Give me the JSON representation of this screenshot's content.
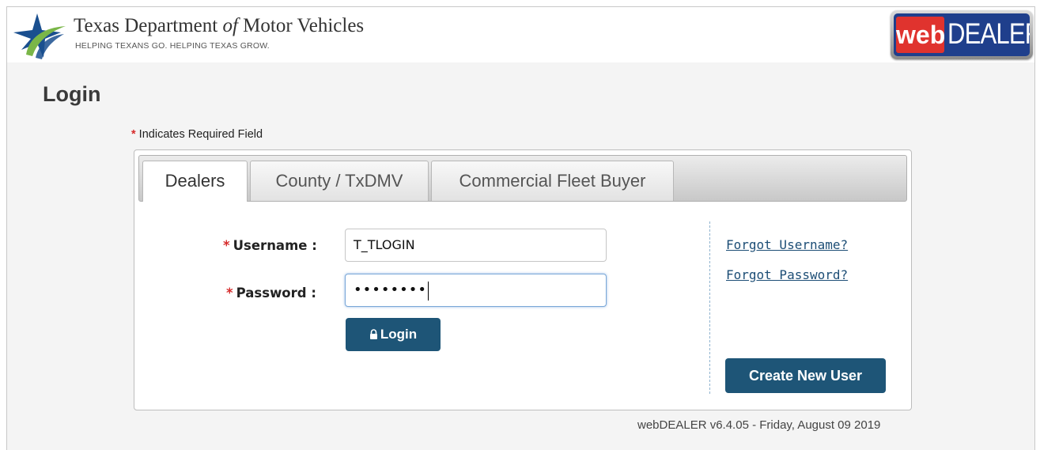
{
  "header": {
    "agency_name_part1": "Texas Department ",
    "agency_name_of": "of",
    "agency_name_part2": " Motor Vehicles",
    "agency_tagline": "HELPING TEXANS GO. HELPING TEXAS GROW.",
    "logo_web": "web",
    "logo_dealer": "DEALER"
  },
  "page": {
    "title": "Login",
    "required_star": "*",
    "required_note": " Indicates Required Field"
  },
  "tabs": [
    {
      "label": "Dealers",
      "active": true
    },
    {
      "label": "County / TxDMV",
      "active": false
    },
    {
      "label": "Commercial Fleet Buyer",
      "active": false
    }
  ],
  "form": {
    "username_label": "Username :",
    "username_value": "T_TLOGIN",
    "password_label": "Password :",
    "password_masked": "••••••••",
    "login_icon": "lock-icon",
    "login_button": "Login"
  },
  "links": {
    "forgot_username": "Forgot Username?",
    "forgot_password": "Forgot Password?"
  },
  "create_user_button": "Create New User",
  "footer": {
    "version": "webDEALER v6.4.05 - Friday, August 09 2019"
  },
  "colors": {
    "button": "#1e5577",
    "required": "#d62b2b",
    "link": "#1d4e76",
    "logo_blue": "#1f3f8c",
    "logo_red": "#e0332e",
    "star_blue": "#1a4f8f",
    "star_green": "#7ab648"
  }
}
